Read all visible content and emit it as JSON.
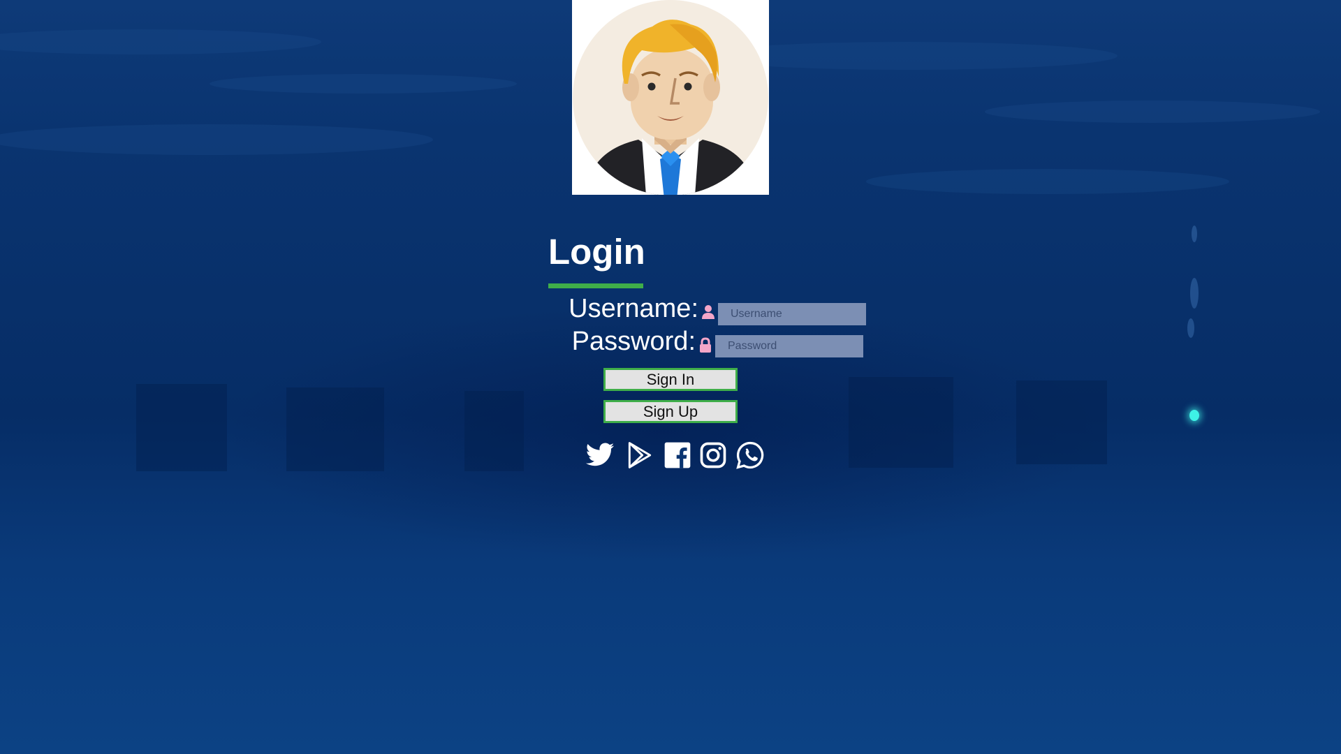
{
  "page": {
    "title": "Login"
  },
  "avatar": {
    "icon": "businessman-avatar-icon"
  },
  "form": {
    "username_label": "Username:",
    "username_icon": "user-icon",
    "username_placeholder": "Username",
    "username_value": "",
    "password_label": "Password:",
    "password_icon": "lock-icon",
    "password_placeholder": "Password",
    "password_value": ""
  },
  "buttons": {
    "sign_in": "Sign In",
    "sign_up": "Sign Up"
  },
  "social": [
    {
      "name": "twitter-icon"
    },
    {
      "name": "google-play-icon"
    },
    {
      "name": "facebook-icon"
    },
    {
      "name": "instagram-icon"
    },
    {
      "name": "whatsapp-icon"
    }
  ],
  "colors": {
    "accent_green": "#3fae49",
    "icon_pink": "#f4a6c8",
    "input_bg": "#7c8fb4",
    "background_blue": "#08306a"
  }
}
